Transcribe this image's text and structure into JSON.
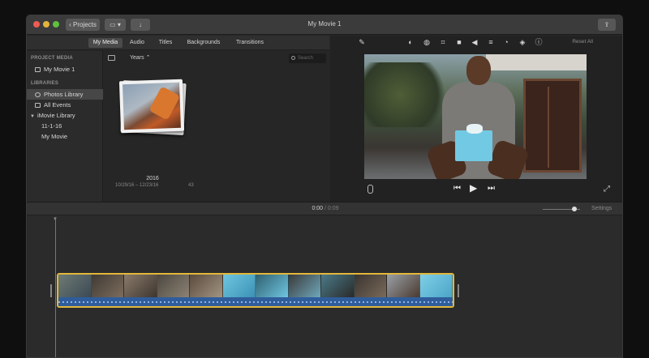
{
  "window": {
    "title": "My Movie 1",
    "projects_label": "‹ Projects",
    "layout_label": "▭ ▾",
    "import_label": "↓",
    "share_label": "⇪"
  },
  "browser": {
    "tabs": [
      {
        "label": "My Media",
        "active": true
      },
      {
        "label": "Audio"
      },
      {
        "label": "Titles"
      },
      {
        "label": "Backgrounds"
      },
      {
        "label": "Transitions"
      }
    ],
    "sidebar": {
      "project_media_heading": "PROJECT MEDIA",
      "project": "My Movie 1",
      "libraries_heading": "LIBRARIES",
      "photos_library": "Photos Library",
      "all_events": "All Events",
      "imovie_library": "iMovie Library",
      "event_date": "11-1-16",
      "my_movie": "My Movie"
    },
    "media": {
      "years_label": "Years ⌃",
      "search_placeholder": "Search",
      "album_title": "2016",
      "album_dates": "10/29/16 – 12/23/16",
      "album_count": "43"
    }
  },
  "viewer": {
    "reset_all": "Reset All",
    "icons": [
      "magic-wand-icon",
      "color-balance-icon",
      "color-correction-icon",
      "crop-icon",
      "camera-icon",
      "volume-icon",
      "equalizer-icon",
      "speed-icon",
      "noise-reduction-icon",
      "info-icon"
    ]
  },
  "timeline": {
    "current_time": "0:00",
    "separator": "/",
    "total_time": "0:09",
    "settings_label": "Settings",
    "zoom_level": 0.78
  },
  "colors": {
    "clip_border": "#e2b73b",
    "audio_track": "#2f5d9c",
    "selected_item": "#474747"
  }
}
